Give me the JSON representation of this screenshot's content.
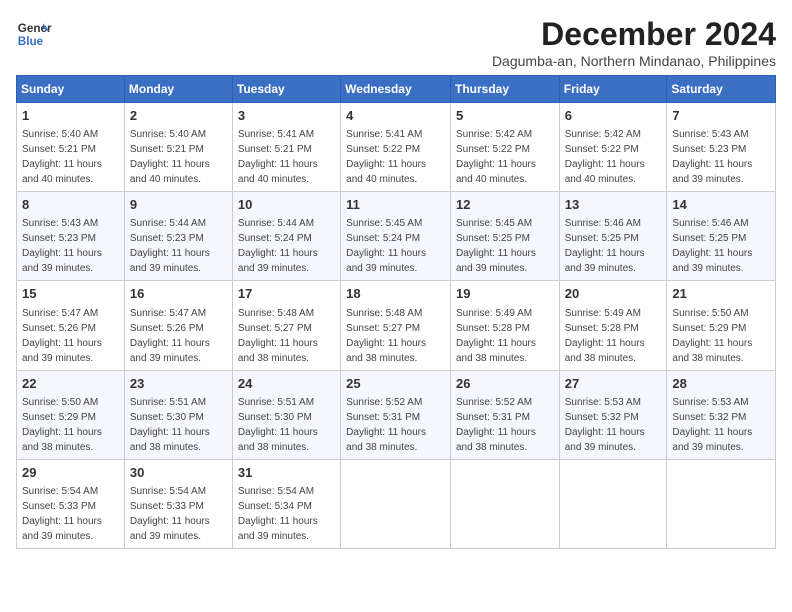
{
  "header": {
    "logo_line1": "General",
    "logo_line2": "Blue",
    "month": "December 2024",
    "location": "Dagumba-an, Northern Mindanao, Philippines"
  },
  "weekdays": [
    "Sunday",
    "Monday",
    "Tuesday",
    "Wednesday",
    "Thursday",
    "Friday",
    "Saturday"
  ],
  "weeks": [
    [
      {
        "day": "1",
        "info": "Sunrise: 5:40 AM\nSunset: 5:21 PM\nDaylight: 11 hours\nand 40 minutes."
      },
      {
        "day": "2",
        "info": "Sunrise: 5:40 AM\nSunset: 5:21 PM\nDaylight: 11 hours\nand 40 minutes."
      },
      {
        "day": "3",
        "info": "Sunrise: 5:41 AM\nSunset: 5:21 PM\nDaylight: 11 hours\nand 40 minutes."
      },
      {
        "day": "4",
        "info": "Sunrise: 5:41 AM\nSunset: 5:22 PM\nDaylight: 11 hours\nand 40 minutes."
      },
      {
        "day": "5",
        "info": "Sunrise: 5:42 AM\nSunset: 5:22 PM\nDaylight: 11 hours\nand 40 minutes."
      },
      {
        "day": "6",
        "info": "Sunrise: 5:42 AM\nSunset: 5:22 PM\nDaylight: 11 hours\nand 40 minutes."
      },
      {
        "day": "7",
        "info": "Sunrise: 5:43 AM\nSunset: 5:23 PM\nDaylight: 11 hours\nand 39 minutes."
      }
    ],
    [
      {
        "day": "8",
        "info": "Sunrise: 5:43 AM\nSunset: 5:23 PM\nDaylight: 11 hours\nand 39 minutes."
      },
      {
        "day": "9",
        "info": "Sunrise: 5:44 AM\nSunset: 5:23 PM\nDaylight: 11 hours\nand 39 minutes."
      },
      {
        "day": "10",
        "info": "Sunrise: 5:44 AM\nSunset: 5:24 PM\nDaylight: 11 hours\nand 39 minutes."
      },
      {
        "day": "11",
        "info": "Sunrise: 5:45 AM\nSunset: 5:24 PM\nDaylight: 11 hours\nand 39 minutes."
      },
      {
        "day": "12",
        "info": "Sunrise: 5:45 AM\nSunset: 5:25 PM\nDaylight: 11 hours\nand 39 minutes."
      },
      {
        "day": "13",
        "info": "Sunrise: 5:46 AM\nSunset: 5:25 PM\nDaylight: 11 hours\nand 39 minutes."
      },
      {
        "day": "14",
        "info": "Sunrise: 5:46 AM\nSunset: 5:25 PM\nDaylight: 11 hours\nand 39 minutes."
      }
    ],
    [
      {
        "day": "15",
        "info": "Sunrise: 5:47 AM\nSunset: 5:26 PM\nDaylight: 11 hours\nand 39 minutes."
      },
      {
        "day": "16",
        "info": "Sunrise: 5:47 AM\nSunset: 5:26 PM\nDaylight: 11 hours\nand 39 minutes."
      },
      {
        "day": "17",
        "info": "Sunrise: 5:48 AM\nSunset: 5:27 PM\nDaylight: 11 hours\nand 38 minutes."
      },
      {
        "day": "18",
        "info": "Sunrise: 5:48 AM\nSunset: 5:27 PM\nDaylight: 11 hours\nand 38 minutes."
      },
      {
        "day": "19",
        "info": "Sunrise: 5:49 AM\nSunset: 5:28 PM\nDaylight: 11 hours\nand 38 minutes."
      },
      {
        "day": "20",
        "info": "Sunrise: 5:49 AM\nSunset: 5:28 PM\nDaylight: 11 hours\nand 38 minutes."
      },
      {
        "day": "21",
        "info": "Sunrise: 5:50 AM\nSunset: 5:29 PM\nDaylight: 11 hours\nand 38 minutes."
      }
    ],
    [
      {
        "day": "22",
        "info": "Sunrise: 5:50 AM\nSunset: 5:29 PM\nDaylight: 11 hours\nand 38 minutes."
      },
      {
        "day": "23",
        "info": "Sunrise: 5:51 AM\nSunset: 5:30 PM\nDaylight: 11 hours\nand 38 minutes."
      },
      {
        "day": "24",
        "info": "Sunrise: 5:51 AM\nSunset: 5:30 PM\nDaylight: 11 hours\nand 38 minutes."
      },
      {
        "day": "25",
        "info": "Sunrise: 5:52 AM\nSunset: 5:31 PM\nDaylight: 11 hours\nand 38 minutes."
      },
      {
        "day": "26",
        "info": "Sunrise: 5:52 AM\nSunset: 5:31 PM\nDaylight: 11 hours\nand 38 minutes."
      },
      {
        "day": "27",
        "info": "Sunrise: 5:53 AM\nSunset: 5:32 PM\nDaylight: 11 hours\nand 39 minutes."
      },
      {
        "day": "28",
        "info": "Sunrise: 5:53 AM\nSunset: 5:32 PM\nDaylight: 11 hours\nand 39 minutes."
      }
    ],
    [
      {
        "day": "29",
        "info": "Sunrise: 5:54 AM\nSunset: 5:33 PM\nDaylight: 11 hours\nand 39 minutes."
      },
      {
        "day": "30",
        "info": "Sunrise: 5:54 AM\nSunset: 5:33 PM\nDaylight: 11 hours\nand 39 minutes."
      },
      {
        "day": "31",
        "info": "Sunrise: 5:54 AM\nSunset: 5:34 PM\nDaylight: 11 hours\nand 39 minutes."
      },
      null,
      null,
      null,
      null
    ]
  ]
}
